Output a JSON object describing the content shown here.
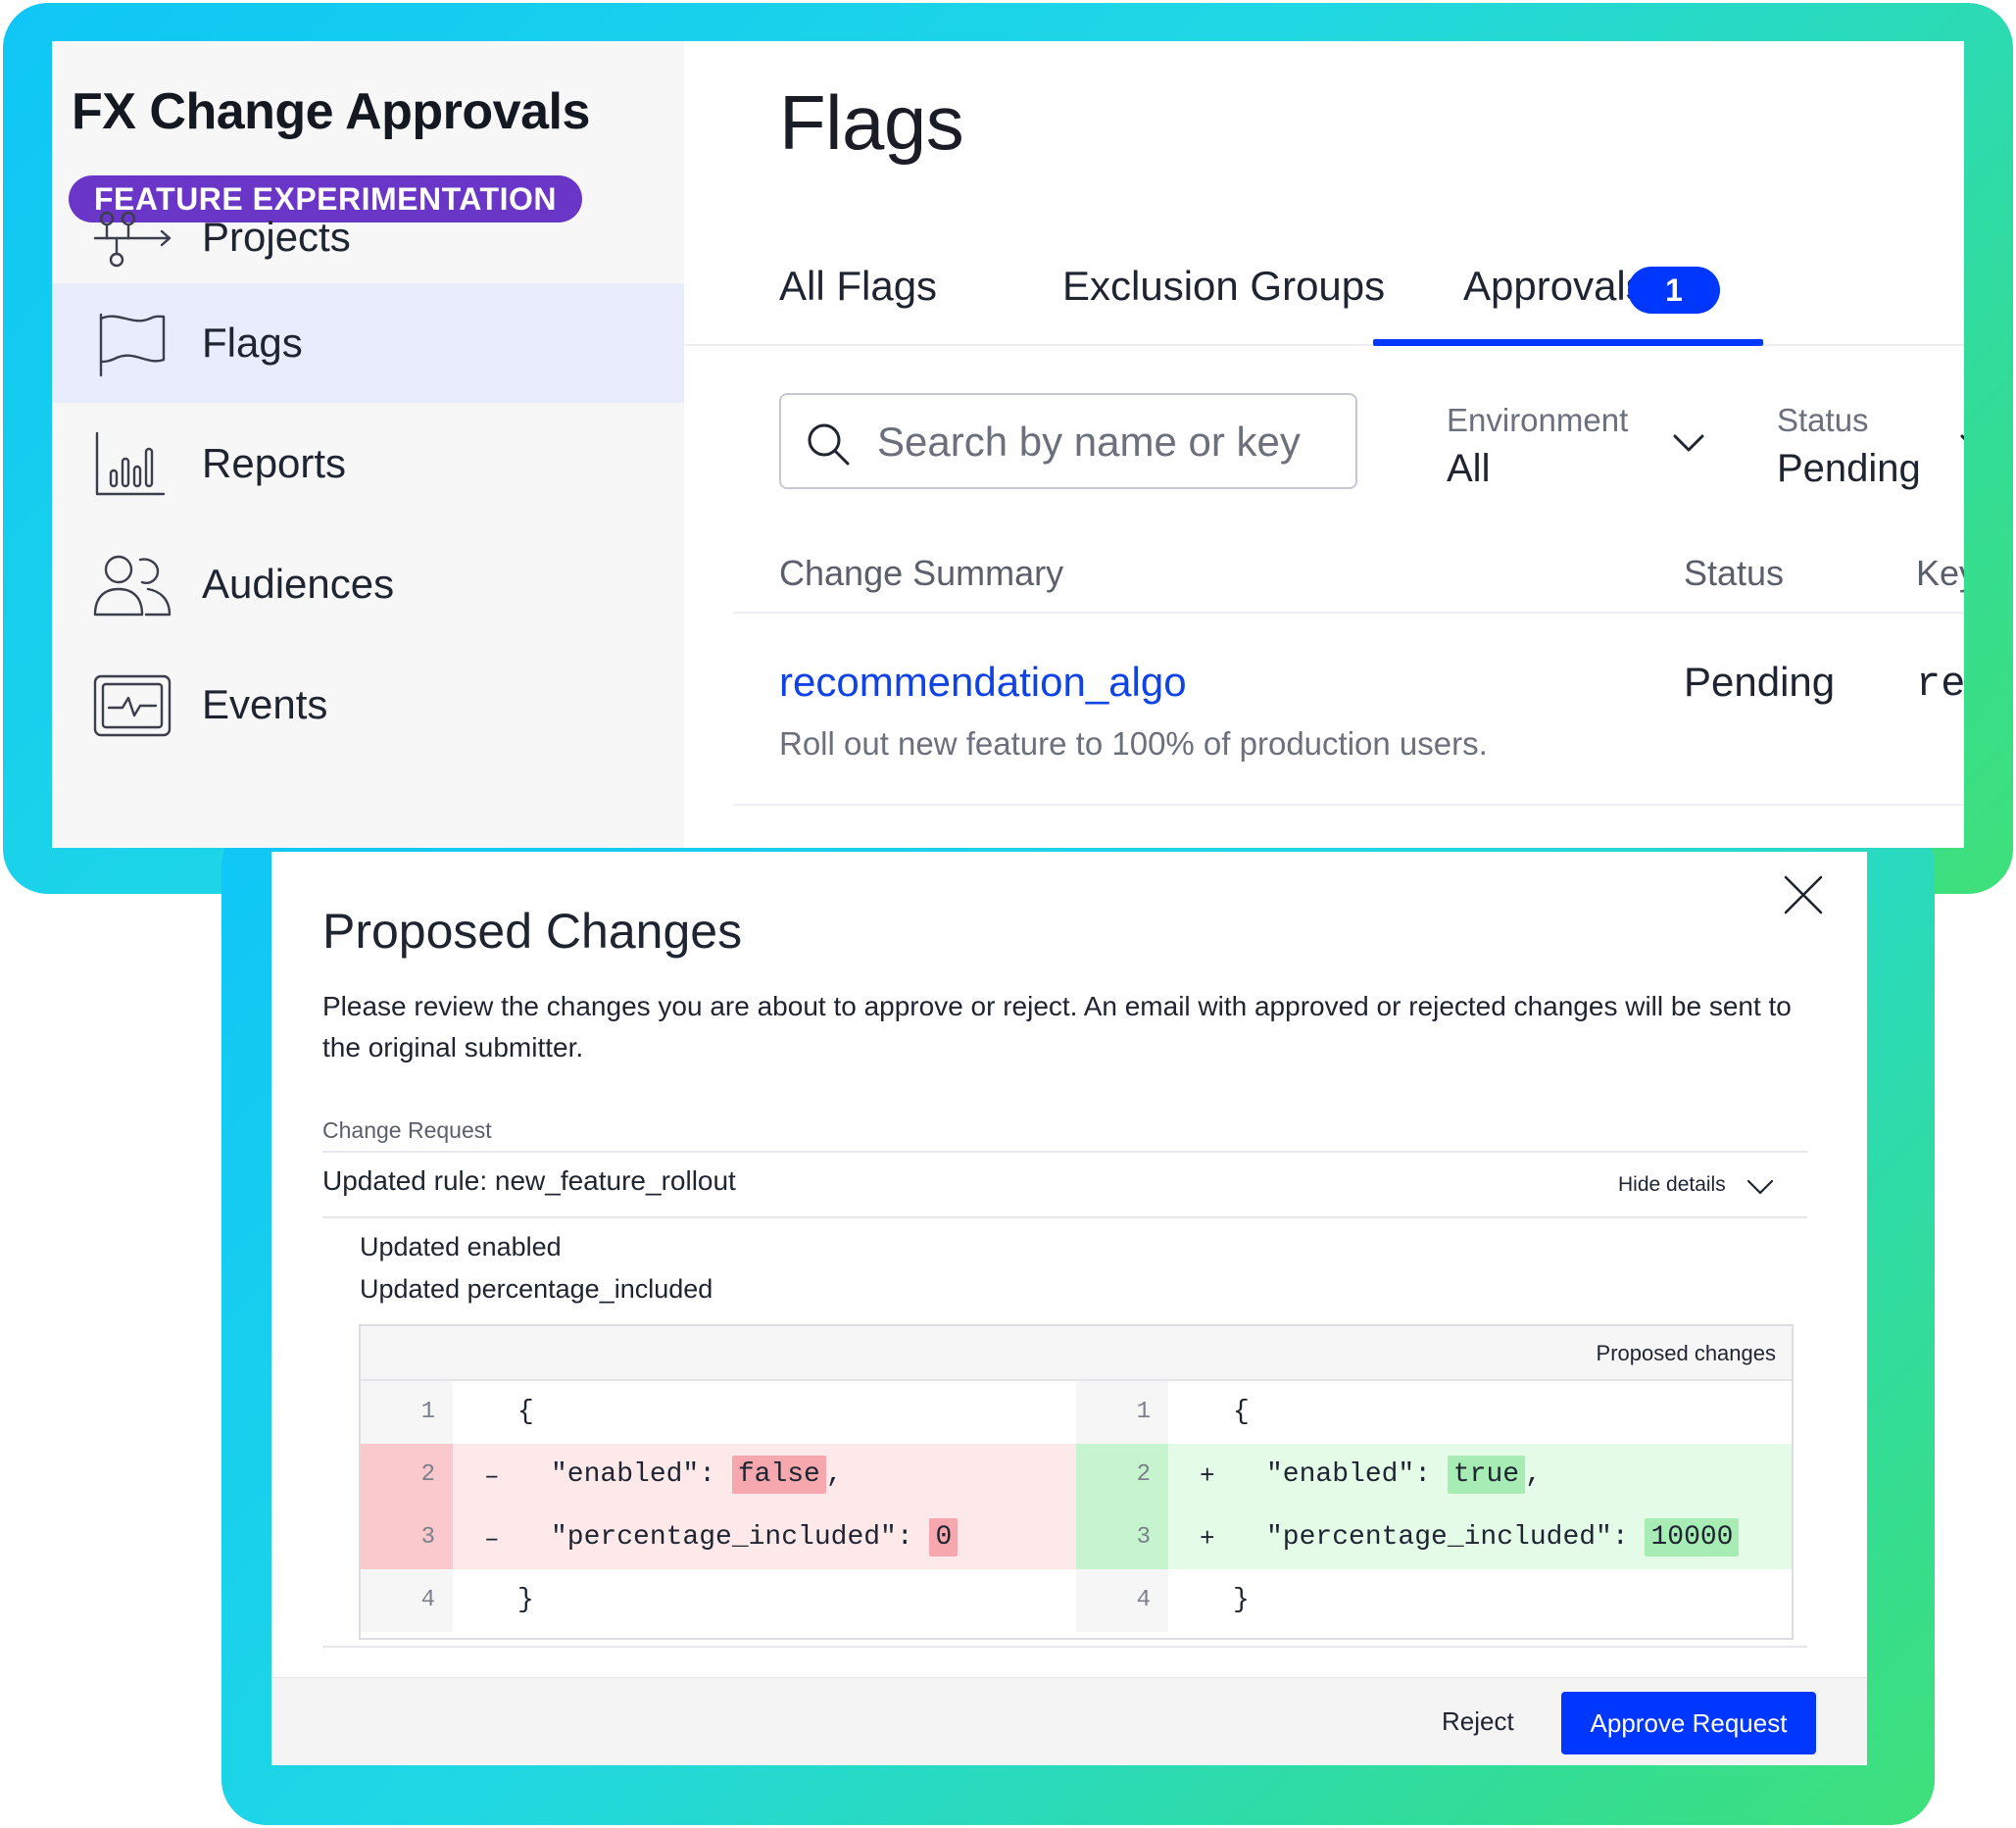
{
  "sidebar": {
    "app_title": "FX Change Approvals",
    "product_badge": "FEATURE EXPERIMENTATION",
    "items": [
      {
        "label": "Projects",
        "icon": "projects-icon",
        "active": false
      },
      {
        "label": "Flags",
        "icon": "flag-icon",
        "active": true
      },
      {
        "label": "Reports",
        "icon": "reports-icon",
        "active": false
      },
      {
        "label": "Audiences",
        "icon": "audiences-icon",
        "active": false
      },
      {
        "label": "Events",
        "icon": "events-icon",
        "active": false
      }
    ]
  },
  "main": {
    "title": "Flags",
    "tabs": [
      {
        "label": "All Flags"
      },
      {
        "label": "Exclusion Groups"
      },
      {
        "label": "Approvals",
        "count": "1",
        "active": true
      }
    ],
    "search": {
      "placeholder": "Search by name or key",
      "value": ""
    },
    "filters": [
      {
        "label": "Environment",
        "value": "All"
      },
      {
        "label": "Status",
        "value": "Pending"
      }
    ],
    "table": {
      "columns": [
        "Change Summary",
        "Status",
        "Key"
      ],
      "rows": [
        {
          "name": "recommendation_algo",
          "description": "Roll out new feature to 100% of production users.",
          "status": "Pending",
          "key": "reco"
        }
      ]
    }
  },
  "modal": {
    "title": "Proposed Changes",
    "description": "Please review the changes you are about to approve or reject. An email with approved or rejected changes will be sent to the original submitter.",
    "section_label": "Change Request",
    "change_title": "Updated rule: new_feature_rollout",
    "hide_details": "Hide details",
    "updates": [
      "Updated enabled",
      "Updated percentage_included"
    ],
    "diff": {
      "header": "Proposed changes",
      "left": [
        {
          "num": "1",
          "sign": "",
          "text": "{"
        },
        {
          "num": "2",
          "sign": "–",
          "key": "\"enabled\": ",
          "value": "false",
          "suffix": ","
        },
        {
          "num": "3",
          "sign": "–",
          "key": "\"percentage_included\": ",
          "value": "0",
          "suffix": ""
        },
        {
          "num": "4",
          "sign": "",
          "text": "}"
        }
      ],
      "right": [
        {
          "num": "1",
          "sign": "",
          "text": "{"
        },
        {
          "num": "2",
          "sign": "+",
          "key": "\"enabled\": ",
          "value": "true",
          "suffix": ","
        },
        {
          "num": "3",
          "sign": "+",
          "key": "\"percentage_included\": ",
          "value": "10000",
          "suffix": ""
        },
        {
          "num": "4",
          "sign": "",
          "text": "}"
        }
      ]
    },
    "buttons": {
      "reject": "Reject",
      "approve": "Approve Request"
    }
  },
  "colors": {
    "accent": "#0037ff",
    "badge": "#6a36c8",
    "link": "#0f43e8",
    "removed": "#fde8ea",
    "removed_highlight": "#f7a8ae",
    "added": "#e4fbe8",
    "added_highlight": "#a7ecb4",
    "frame_gradient": [
      "#0fc6f6",
      "#3fe07a"
    ]
  }
}
